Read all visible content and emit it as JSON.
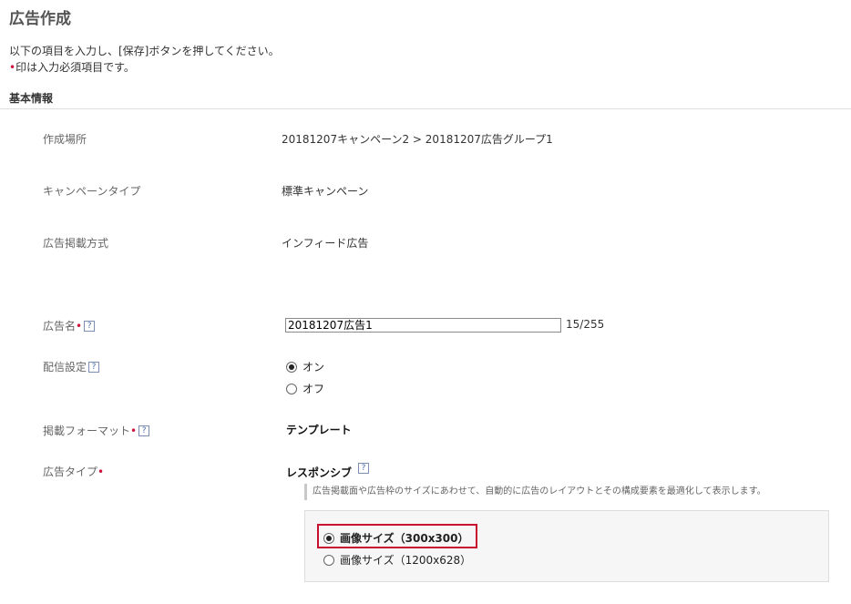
{
  "page": {
    "title": "広告作成",
    "intro_line1": "以下の項目を入力し、[保存]ボタンを押してください。",
    "intro_line2_mark": "•",
    "intro_line2": "印は入力必須項目です。",
    "section_title": "基本情報"
  },
  "fields": {
    "location_label": "作成場所",
    "location_value": "20181207キャンペーン2 > 20181207広告グループ1",
    "campaign_type_label": "キャンペーンタイプ",
    "campaign_type_value": "標準キャンペーン",
    "placement_label": "広告掲載方式",
    "placement_value": "インフィード広告",
    "ad_name_label": "広告名",
    "ad_name_value": "20181207広告1",
    "ad_name_counter": "15/255",
    "delivery_label": "配信設定",
    "delivery_on": "オン",
    "delivery_off": "オフ",
    "format_label": "掲載フォーマット",
    "format_value": "テンプレート",
    "ad_type_label": "広告タイプ",
    "ad_type_value": "レスポンシブ",
    "ad_type_note": "広告掲載面や広告枠のサイズにあわせて、自動的に広告のレイアウトとその構成要素を最適化して表示します。",
    "image_size_option1": "画像サイズ（300x300）",
    "image_size_option2": "画像サイズ（1200x628）"
  },
  "help_glyph": "?",
  "required_mark": "•",
  "colors": {
    "required": "#d0103a",
    "highlight_border": "#c8102e"
  },
  "state": {
    "delivery_selected": "オン",
    "image_size_selected": "画像サイズ（300x300）"
  }
}
